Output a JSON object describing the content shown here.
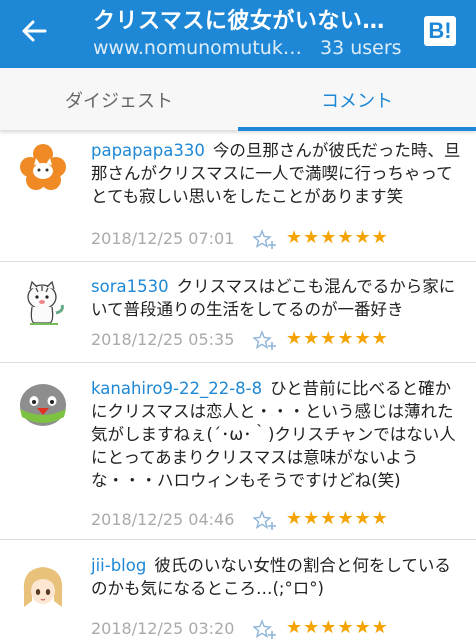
{
  "header": {
    "title": "クリスマスに彼女がいない…",
    "url": "www.nomunomutuk…",
    "users": "33 users",
    "logo": "B!"
  },
  "tabs": [
    {
      "label": "ダイジェスト"
    },
    {
      "label": "コメント"
    }
  ],
  "comments": [
    {
      "user": "papapapa330",
      "text": "今の旦那さんが彼氏だった時、旦那さんがクリスマスに一人で満喫に行っちゃってとても寂しい思いをしたことがあります笑",
      "time": "2018/12/25 07:01",
      "stars": "★★★★★★",
      "avatar": "orange-cat-avatar"
    },
    {
      "user": "sora1530",
      "text": "クリスマスはどこも混んでるから家にいて普段通りの生活をしてるのが一番好き",
      "time": "2018/12/25 05:35",
      "stars": "★★★★★★",
      "avatar": "white-tiger-avatar"
    },
    {
      "user": "kanahiro9-22_22-8-8",
      "text": "ひと昔前に比べると確かにクリスマスは恋人と・・・という感じは薄れた気がしますねぇ(´･ω･｀)クリスチャンではない人にとってあまりクリスマスは意味がないような・・・ハロウィンもそうですけどね(笑)",
      "time": "2018/12/25 04:46",
      "stars": "★★★★★★",
      "avatar": "gray-blob-avatar"
    },
    {
      "user": "jii-blog",
      "text": "彼氏のいない女性の割合と何をしているのかも気になるところ…(;°ロ°)",
      "time": "2018/12/25 03:20",
      "stars": "★★★★★★",
      "avatar": "anime-girl-avatar"
    }
  ],
  "colors": {
    "accent": "#1e88d6",
    "star": "#f4a300",
    "time": "#aaaaaa"
  }
}
